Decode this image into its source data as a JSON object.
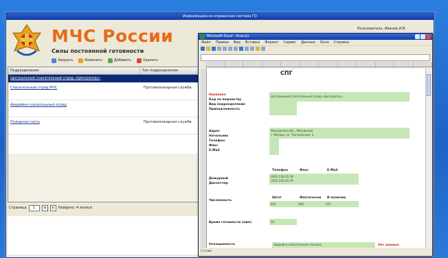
{
  "app": {
    "window_title": "Информационно-справочная система ГО",
    "brand_title": "МЧС России",
    "brand_subtitle": "Силы постоянной готовности",
    "user_label": "Пользователь: Иванов И.И.",
    "toolbar": [
      {
        "label": "Закрыть",
        "icon": "close-doc-icon",
        "color": "#4a86d8"
      },
      {
        "label": "Изменить",
        "icon": "edit-icon",
        "color": "#e9a020"
      },
      {
        "label": "Добавить",
        "icon": "add-icon",
        "color": "#54a84a"
      },
      {
        "label": "Удалить",
        "icon": "delete-icon",
        "color": "#d24a3a"
      }
    ]
  },
  "grid": {
    "columns": [
      "Подразделение",
      "Тип подразделения"
    ],
    "rows": [
      {
        "name": "Центральный спасательный отряд «Центроспас»",
        "type": "",
        "selected": true
      },
      {
        "name": "Спасательный отряд МЧС",
        "type": "Противопожарная служба",
        "selected": false
      },
      {
        "name": "Аварийно-спасательный отряд",
        "type": "",
        "selected": false
      },
      {
        "name": "Пожарная часть",
        "type": "Противопожарная служба",
        "selected": false
      }
    ]
  },
  "pager": {
    "label": "Страница",
    "page": "1",
    "total_label": "Найдено: 4 записи"
  },
  "sheet": {
    "window_title": "Microsoft Excel - Книга1",
    "menu": [
      "Файл",
      "Правка",
      "Вид",
      "Вставка",
      "Формат",
      "Сервис",
      "Данные",
      "Окно",
      "Справка"
    ],
    "title": "СПГ",
    "labels_block1": [
      "Название",
      "Код по ведомству",
      "Вид подразделения",
      "Принадлежность"
    ],
    "value_block1": "Центральный спасательный отряд «Центроспас»",
    "labels_block2": [
      "Адрес",
      "Начальник",
      "Телефон",
      "Факс",
      "E-Mail"
    ],
    "value_block2a": "Московская обл., Жуковский",
    "value_block2b": "г. Москва, ул. Театральная, 3",
    "contacts_headers": [
      "Телефон",
      "Факс",
      "E-Mail"
    ],
    "labels_block3": [
      "Дежурный",
      "Диспетчер"
    ],
    "contacts_values": [
      "(495) 556-05-78",
      "(495) 556-05-79"
    ],
    "personnel_label": "Численность",
    "personnel_headers": [
      "Штат",
      "Фактически",
      "В наличии"
    ],
    "personnel_values": [
      "420",
      "398",
      "375"
    ],
    "readiness_label": "Время готовности (мин)",
    "readiness_value": "30",
    "equipment_label": "Оснащенность",
    "equipment_value": "Аварийно-спасательная техника",
    "equipment_flag": "Нет данных",
    "status": "Готово"
  },
  "colors": {
    "accent": "#e86a18",
    "selection": "#0a2a78",
    "sheet_fill": "#c7e6b5",
    "desktop": "#1f6ed1"
  }
}
